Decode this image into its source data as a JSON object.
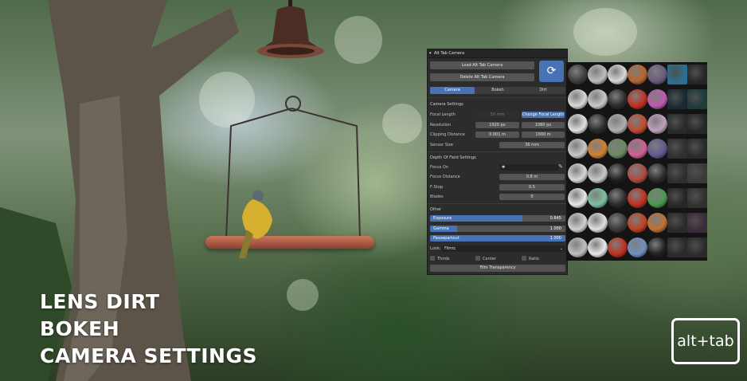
{
  "overlay": {
    "line1": "LENS DIRT",
    "line2": "BOKEH",
    "line3": "CAMERA SETTINGS"
  },
  "logo": "alt+tab",
  "panel": {
    "title": "Alt Tab Camera",
    "load_button": "Load Alt Tab Camera",
    "delete_button": "Delete Alt Tab Camera",
    "tabs": [
      "Camera",
      "Bokeh",
      "Dirt"
    ],
    "camera_settings": {
      "header": "Camera Settings",
      "focal_length_label": "Focal Length",
      "focal_length_value": "50 mm",
      "change_focal_button": "Change Focal Length",
      "resolution_label": "Resolution",
      "resolution_x": "1920 px",
      "resolution_y": "1080 px",
      "clipping_label": "Clipping Distance",
      "clip_start": "0.001 m",
      "clip_end": "1000 m",
      "sensor_label": "Sensor Size",
      "sensor_value": "36 mm"
    },
    "dof": {
      "header": "Depth Of Field Settings",
      "focus_on_label": "Focus On",
      "focus_distance_label": "Focus Distance",
      "focus_distance_value": "0.8 m",
      "fstop_label": "F-Stop",
      "fstop_value": "0.5",
      "blades_label": "Blades",
      "blades_value": "0"
    },
    "other": {
      "header": "Other",
      "sliders": [
        {
          "label": "Exposure",
          "value": "0.645",
          "fill": 0.68
        },
        {
          "label": "Gamma",
          "value": "1.000",
          "fill": 0.2
        },
        {
          "label": "Passepartout",
          "value": "1.000",
          "fill": 1.0
        }
      ],
      "look_label": "Look:",
      "look_value": "Filmic",
      "checkboxes": [
        "Thirds",
        "Center",
        "Ratio"
      ],
      "film_button": "Film Transparency"
    }
  },
  "thumbnails": {
    "colors": [
      [
        "#3d3d3d",
        "#bdbdbd",
        "#d8d8d8",
        "#b8652c",
        "#6a5a80",
        "#2a6f90",
        "#262626"
      ],
      [
        "#d8d8d8",
        "#c8c8c8",
        "#2a2a2a",
        "#c03020",
        "#c05ab0",
        "#1a2a30",
        "#1f3a3a"
      ],
      [
        "#e0e0e0",
        "#2a2a2a",
        "#b0b0b0",
        "#c04b30",
        "#c0a0c0",
        "#2a2a2a",
        "#262626"
      ],
      [
        "#c8c8c8",
        "#d08030",
        "#6a8a60",
        "#d06090",
        "#605a90",
        "#303030",
        "#2a2a2a"
      ],
      [
        "#d8d8d8",
        "#c8c8c8",
        "#1f1f1f",
        "#b04a40",
        "#2a2a2a",
        "#2e2e2e",
        "#3a3a3a"
      ],
      [
        "#e8e8e8",
        "#7fc0a0",
        "#2a2a2a",
        "#c03020",
        "#4a9a50",
        "#262626",
        "#303030"
      ],
      [
        "#d0d0d0",
        "#e0e0e0",
        "#3a3a3a",
        "#c04020",
        "#c07030",
        "#2a2a2a",
        "#3a2a3a"
      ],
      [
        "#c0c0c0",
        "#e8e8e8",
        "#c03020",
        "#7090c0",
        "#1f1f1f",
        "#2a2a2a",
        "#2a2a2a"
      ]
    ]
  }
}
